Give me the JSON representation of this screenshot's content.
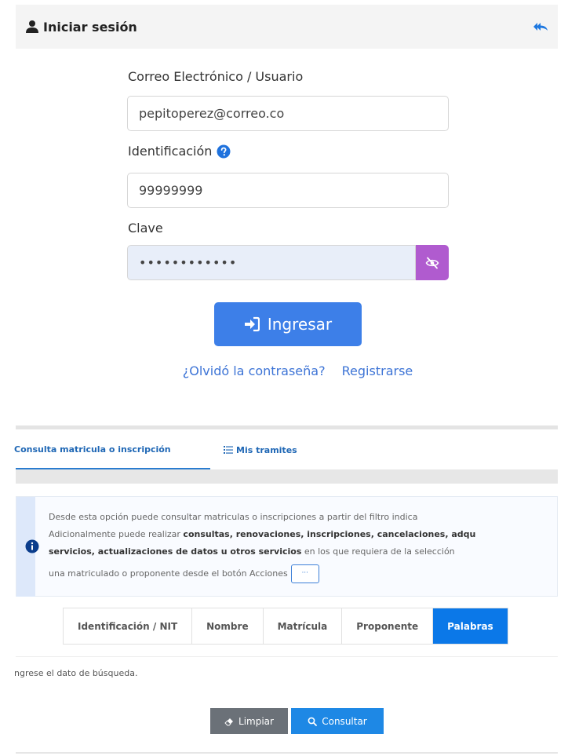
{
  "header": {
    "title": "Iniciar sesión"
  },
  "form": {
    "email_label": "Correo Electrónico / Usuario",
    "email_value": "pepitoperez@correo.co",
    "id_label": "Identificación",
    "id_value": "99999999",
    "password_label": "Clave",
    "password_value": "••••••••••••",
    "login_label": "Ingresar",
    "forgot_label": "¿Olvidó la contraseña?",
    "register_label": "Registrarse"
  },
  "tabs": {
    "tab1_label": "Consulta matricula o inscripción",
    "tab2_label": "Mis tramites"
  },
  "info": {
    "line1": "Desde esta opción puede consultar matriculas o inscripciones a partir del filtro indica",
    "line2_plain": "Adicionalmente puede realizar ",
    "line2_bold": "consultas, renovaciones, inscripciones, cancelaciones, adqu",
    "line3_bold": "servicios, actualizaciones de datos u otros servicios",
    "line3_plain": " en los que requiera de la selección",
    "line4": "una matriculado o proponente desde el botón Acciones",
    "dots": "···"
  },
  "filters": [
    "Identificación / NIT",
    "Nombre",
    "Matrícula",
    "Proponente",
    "Palabras"
  ],
  "active_filter": "Palabras",
  "search_hint": "ngrese el dato de búsqueda.",
  "buttons": {
    "clear": "Limpiar",
    "search": "Consultar"
  },
  "colors": {
    "primary": "#3d7fe8",
    "eye_button": "#b05bcf",
    "active_filter": "#0b78e8",
    "clear_button": "#6b7178",
    "search_button": "#1e88e5"
  },
  "icons": [
    "user-icon",
    "back-icon",
    "help-icon",
    "eye-slash-icon",
    "sign-in-icon",
    "list-icon",
    "info-icon",
    "eraser-icon",
    "search-icon"
  ]
}
